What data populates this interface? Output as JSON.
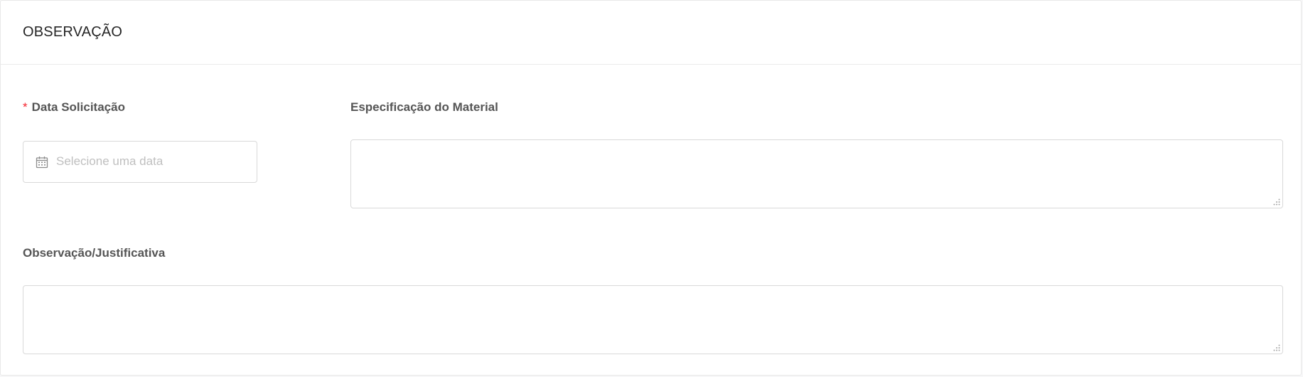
{
  "section": {
    "title": "OBSERVAÇÃO"
  },
  "fields": {
    "data_solicitacao": {
      "required_mark": "*",
      "label": "Data Solicitação",
      "placeholder": "Selecione uma data",
      "value": "",
      "icon": "calendar-icon"
    },
    "especificacao_material": {
      "label": "Especificação do Material",
      "value": ""
    },
    "observacao_justificativa": {
      "label": "Observação/Justificativa",
      "value": ""
    }
  },
  "colors": {
    "required": "#f5222d",
    "label": "#555555",
    "placeholder": "#bfbfbf",
    "border": "#d9d9d9"
  }
}
